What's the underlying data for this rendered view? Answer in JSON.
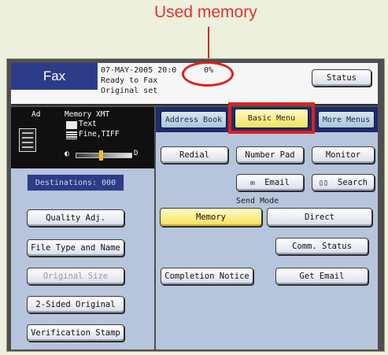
{
  "annotation": {
    "label": "Used memory"
  },
  "header": {
    "mode_title": "Fax",
    "date_time": "07-MAY-2005  20:0",
    "memory_used": "0%",
    "status_ready": "Ready to Fax",
    "status_original": "Original set",
    "status_button": "Status"
  },
  "info_panel": {
    "ad_label": "Ad",
    "memory_label": "Memory XMT",
    "original_type": "Text",
    "resolution": "Fine,TIFF",
    "contrast_end": "D",
    "destinations": "Destinations:  000"
  },
  "tabs": {
    "address_book": "Address Book",
    "basic_menu": "Basic Menu",
    "more_menus": "More Menus"
  },
  "actions": {
    "redial": "Redial",
    "number_pad": "Number Pad",
    "monitor": "Monitor",
    "email": "Email",
    "search": "Search"
  },
  "send_mode": {
    "label": "Send Mode",
    "memory": "Memory",
    "direct": "Direct",
    "selected": "Memory"
  },
  "options": {
    "comm_status": "Comm. Status",
    "completion_notice": "Completion Notice",
    "get_email": "Get Email"
  },
  "left_buttons": {
    "quality_adj": "Quality Adj.",
    "file_type_name": "File Type and Name",
    "original_size": "Original Size",
    "two_sided": "2-Sided Original",
    "verification_stamp": "Verification Stamp"
  },
  "colors": {
    "annotation_red": "#e0201a",
    "header_blue": "#2d3c88",
    "selected_yellow": "#f2e15a",
    "panel_blue": "#b7c5dc"
  }
}
